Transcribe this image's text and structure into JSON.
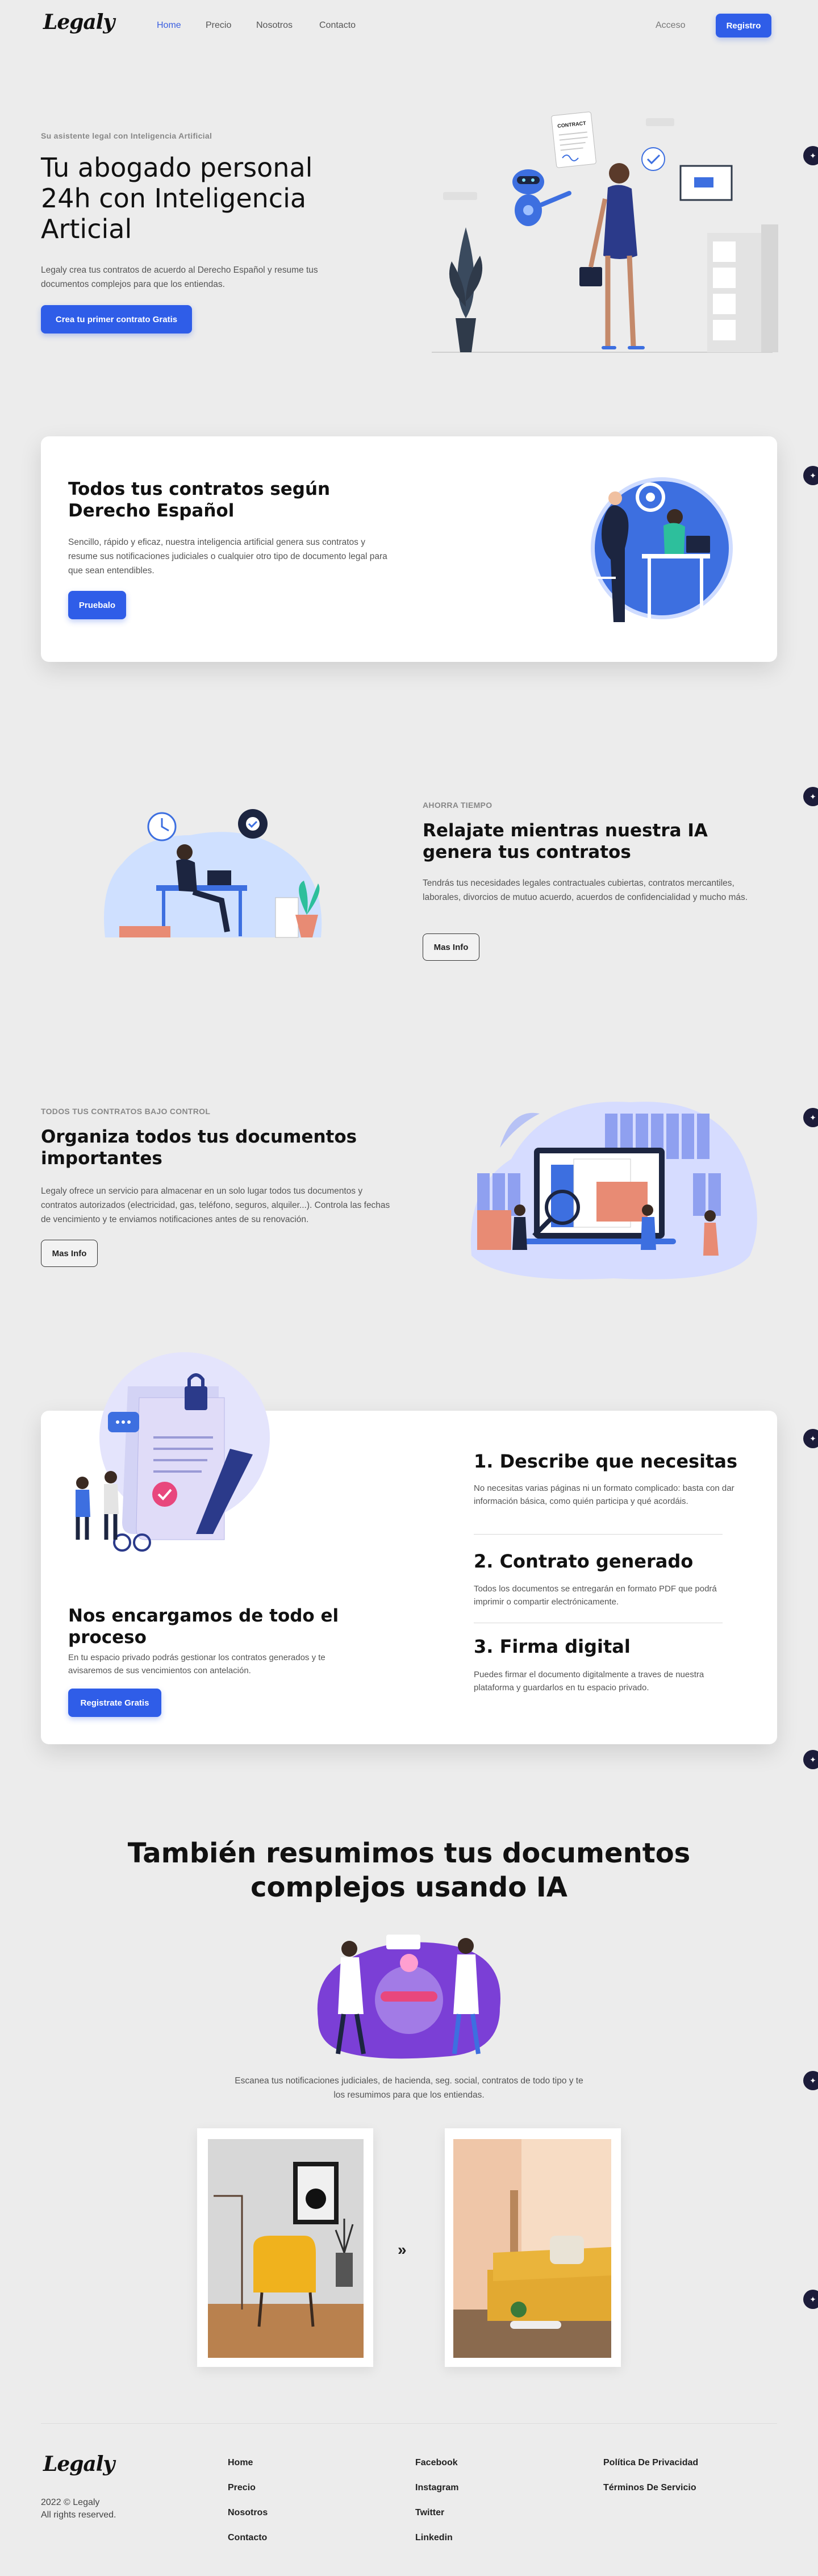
{
  "nav": {
    "logo": "Legaly",
    "links": [
      "Home",
      "Precio",
      "Nosotros",
      "Contacto"
    ],
    "login": "Acceso",
    "register": "Registro"
  },
  "hero": {
    "eyebrow": "Su asistente legal con Inteligencia Artificial",
    "title": "Tu abogado personal 24h con Inteligencia Articial",
    "description": "Legaly crea tus contratos de acuerdo al Derecho Español y resume tus documentos complejos para que los entiendas.",
    "cta": "Crea tu primer contrato Gratis",
    "illustration_text": "CONTRACT"
  },
  "contracts_card": {
    "title": "Todos tus contratos según Derecho Español",
    "description": "Sencillo, rápido y eficaz, nuestra inteligencia artificial genera sus contratos y resume sus notificaciones judiciales o cualquier otro tipo de documento legal para que sean entendibles.",
    "cta": "Pruebalo"
  },
  "relax": {
    "eyebrow": "AHORRA TIEMPO",
    "title": "Relajate mientras nuestra IA genera tus contratos",
    "description": "Tendrás tus necesidades legales contractuales cubiertas, contratos mercantiles, laborales, divorcios de mutuo acuerdo, acuerdos de confidencialidad y mucho más.",
    "cta": "Mas Info"
  },
  "organize": {
    "eyebrow": "TODOS TUS CONTRATOS BAJO CONTROL",
    "title": "Organiza todos tus documentos importantes",
    "description": "Legaly ofrece un servicio para almacenar en un solo lugar todos tus documentos y contratos autorizados (electricidad, gas, teléfono, seguros, alquiler...). Controla las fechas de vencimiento y te enviamos notificaciones antes de su renovación.",
    "cta": "Mas Info"
  },
  "process": {
    "title": "Nos encargamos de todo el proceso",
    "description": "En tu espacio privado podrás gestionar los contratos generados y te avisaremos de sus vencimientos con antelación.",
    "cta": "Registrate Gratis",
    "steps": [
      {
        "title": "1. Describe que necesitas",
        "text": "No necesitas varias páginas ni un formato complicado: basta con dar información básica, como quién participa y qué acordáis."
      },
      {
        "title": "2. Contrato generado",
        "text": "Todos los documentos se entregarán en formato PDF que podrá imprimir o compartir electrónicamente."
      },
      {
        "title": "3. Firma digital",
        "text": "Puedes firmar el documento digitalmente a traves de nuestra plataforma y guardarlos en tu espacio privado."
      }
    ]
  },
  "summary": {
    "title": "También resumimos tus documentos complejos usando IA",
    "description": "Escanea tus notificaciones judiciales, de hacienda, seg. social, contratos de todo tipo y te los resumimos para que los entiendas.",
    "arrow": "»"
  },
  "footer": {
    "logo": "Legaly",
    "copyright": "2022 © Legaly",
    "rights": "All rights reserved.",
    "col1": [
      "Home",
      "Precio",
      "Nosotros",
      "Contacto"
    ],
    "col2": [
      "Facebook",
      "Instagram",
      "Twitter",
      "Linkedin"
    ],
    "col3": [
      "Política De Privacidad",
      "Términos De Servicio"
    ]
  },
  "colors": {
    "accent": "#2f5de8",
    "background": "#ececec",
    "purple": "#7b3fd6",
    "illustration_blue": "#3d6fe0"
  },
  "icons": {
    "side_widget": "sparkle-icon"
  }
}
